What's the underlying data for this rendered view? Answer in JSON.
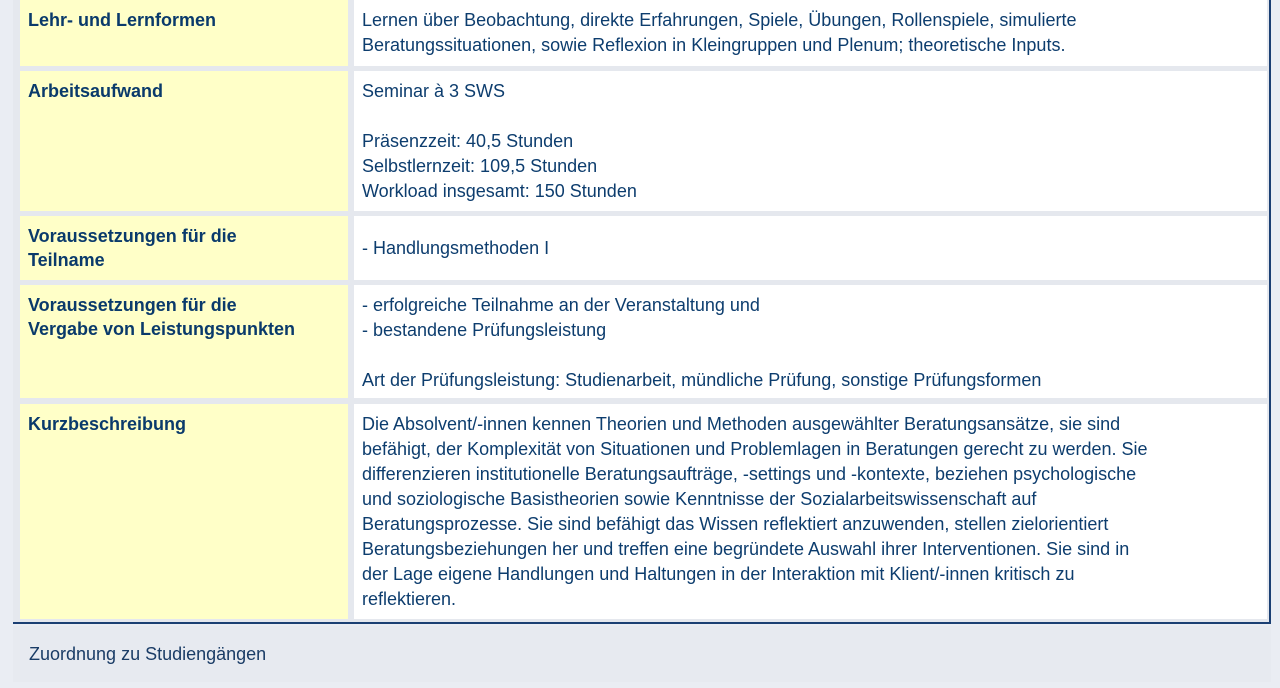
{
  "rows": [
    {
      "label": "Lehr- und Lernformen",
      "lines": [
        "Lernen über Beobachtung, direkte Erfahrungen, Spiele, Übungen, Rollenspiele, simulierte",
        "Beratungssituationen, sowie Reflexion in Kleingruppen und Plenum; theoretische Inputs."
      ]
    },
    {
      "label": "Arbeitsaufwand",
      "lines": [
        "Seminar à 3 SWS",
        "",
        "Präsenzzeit: 40,5 Stunden",
        "Selbstlernzeit: 109,5 Stunden",
        "Workload insgesamt: 150 Stunden"
      ]
    },
    {
      "label_lines": [
        "Voraussetzungen für die",
        "Teilname"
      ],
      "lines": [
        "- Handlungsmethoden I"
      ]
    },
    {
      "label_lines": [
        "Voraussetzungen für die",
        "Vergabe von Leistungspunkten"
      ],
      "lines": [
        "- erfolgreiche Teilnahme an der Veranstaltung und",
        "- bestandene Prüfungsleistung",
        "",
        "Art der Prüfungsleistung: Studienarbeit, mündliche Prüfung, sonstige Prüfungsformen"
      ]
    },
    {
      "label": "Kurzbeschreibung",
      "lines": [
        "Die Absolvent/-innen kennen Theorien und Methoden ausgewählter Beratungsansätze, sie sind",
        "befähigt, der Komplexität von Situationen und Problemlagen in Beratungen gerecht zu werden. Sie",
        "differenzieren institutionelle Beratungsaufträge, -settings und -kontexte, beziehen psychologische",
        "und soziologische Basistheorien sowie Kenntnisse der Sozialarbeitswissenschaft auf",
        "Beratungsprozesse. Sie sind befähigt das Wissen reflektiert anzuwenden, stellen zielorientiert",
        "Beratungsbeziehungen her und treffen eine begründete Auswahl ihrer Interventionen. Sie sind in",
        "der Lage eigene Handlungen und Haltungen in der Interaktion mit Klient/-innen kritisch zu",
        "reflektieren."
      ]
    }
  ],
  "footer": {
    "link_label": "Zuordnung zu Studiengängen"
  }
}
